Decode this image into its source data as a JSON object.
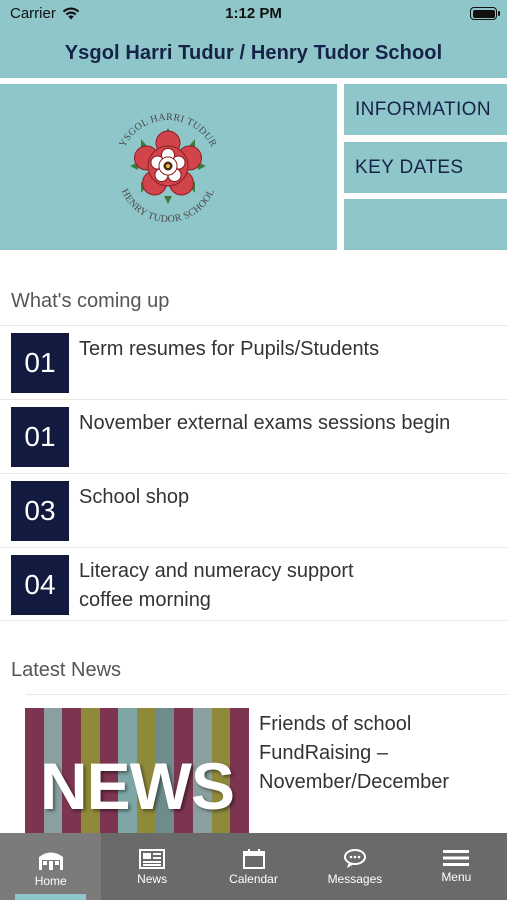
{
  "status_bar": {
    "carrier": "Carrier",
    "time": "1:12 PM"
  },
  "header": {
    "title": "Ysgol Harri Tudur / Henry Tudor School"
  },
  "logo": {
    "arc_top": "YSGOL HARRI TUDUR",
    "arc_bottom": "HENRY TUDOR SCHOOL"
  },
  "tiles": [
    "INFORMATION",
    "KEY DATES",
    ""
  ],
  "coming_up": {
    "title": "What's coming up",
    "events": [
      {
        "day": "01",
        "title": "Term resumes for Pupils/Students"
      },
      {
        "day": "01",
        "title": "November external exams sessions begin"
      },
      {
        "day": "03",
        "title": "School shop"
      },
      {
        "day": "04",
        "title": "Literacy and numeracy support coffee morning"
      }
    ]
  },
  "latest_news": {
    "title": "Latest News",
    "thumb_text": "NEWS",
    "item_title": "Friends of school FundRaising – November/December"
  },
  "tabs": [
    {
      "label": "Home",
      "icon": "home-icon"
    },
    {
      "label": "News",
      "icon": "newspaper-icon"
    },
    {
      "label": "Calendar",
      "icon": "calendar-icon"
    },
    {
      "label": "Messages",
      "icon": "messages-icon"
    },
    {
      "label": "Menu",
      "icon": "menu-icon"
    }
  ],
  "colors": {
    "teal": "#8fc6c9",
    "navy": "#172249",
    "date_box": "#131a3f",
    "tab_bar": "#6a6a6a",
    "rose": "#d0444a"
  }
}
